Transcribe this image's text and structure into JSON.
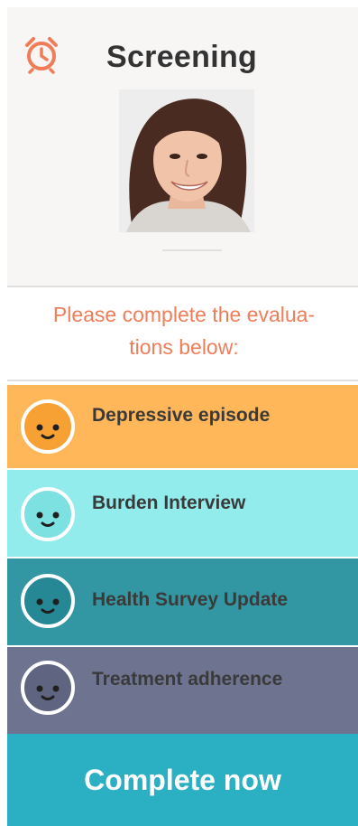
{
  "header": {
    "title": "Screening",
    "alarm_icon": "alarm-clock-icon",
    "alarm_color": "#f07d5a"
  },
  "instructions": {
    "line1": "Please complete the evalua-",
    "line2": "tions below:"
  },
  "evaluations": [
    {
      "label": "Depressive episode",
      "icon": "smiley-face-icon",
      "color": "#ffb75a",
      "face_color": "#f7a033"
    },
    {
      "label": "Burden Interview",
      "icon": "smiley-face-icon",
      "color": "#92ecec",
      "face_color": "#7de1e1"
    },
    {
      "label": "Health Survey Update",
      "icon": "smiley-face-icon",
      "color": "#3396a3",
      "face_color": "#268894"
    },
    {
      "label": "Treatment adherence",
      "icon": "smiley-face-icon",
      "color": "#6e7390",
      "face_color": "#5f6480"
    }
  ],
  "cta": {
    "label": "Complete now",
    "color": "#2aafc3"
  }
}
